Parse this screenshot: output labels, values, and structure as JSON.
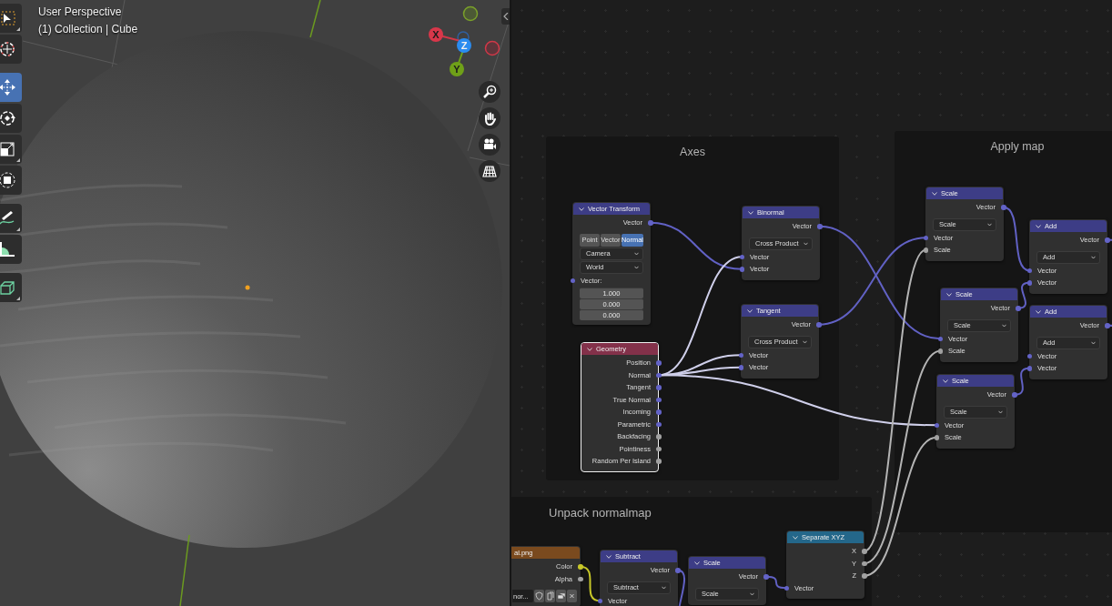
{
  "viewport": {
    "view_name": "User Perspective",
    "object_info": "(1) Collection | Cube",
    "toolbar": [
      {
        "tools": [
          {
            "selected": false
          },
          {
            "selected": false
          }
        ]
      },
      {
        "tools": [
          {
            "selected": true
          },
          {
            "selected": false
          },
          {
            "selected": false
          },
          {
            "selected": false
          }
        ]
      },
      {
        "tools": [
          {
            "selected": false
          },
          {
            "selected": false
          }
        ]
      },
      {
        "tools": [
          {
            "selected": false
          }
        ]
      }
    ],
    "gizmo": {
      "axes": [
        "X",
        "Y",
        "Z"
      ]
    }
  },
  "node_editor": {
    "frames": [
      {
        "label": "Axes"
      },
      {
        "label": "Apply map"
      },
      {
        "label": "Unpack normalmap"
      }
    ],
    "nodes": [
      {
        "title": "Vector Transform",
        "kind": "vector",
        "selected": false,
        "rows": [
          {
            "kind": "output",
            "label": "Vector",
            "color": "#6363c7"
          },
          {
            "kind": "toggle",
            "options": [
              {
                "label": "Point",
                "selected": false
              },
              {
                "label": "Vector",
                "selected": false
              },
              {
                "label": "Normal",
                "selected": true
              }
            ]
          },
          {
            "kind": "dropdown",
            "value": "Camera"
          },
          {
            "kind": "dropdown",
            "value": "World"
          },
          {
            "kind": "input",
            "label": "Vector:",
            "color": "#6363c7"
          },
          {
            "kind": "number",
            "value": "1.000"
          },
          {
            "kind": "number",
            "value": "0.000"
          },
          {
            "kind": "number",
            "value": "0.000"
          }
        ]
      },
      {
        "title": "Geometry",
        "kind": "input",
        "selected": true,
        "rows": [
          {
            "kind": "output",
            "label": "Position",
            "color": "#6363c7"
          },
          {
            "kind": "output",
            "label": "Normal",
            "color": "#6363c7"
          },
          {
            "kind": "output",
            "label": "Tangent",
            "color": "#6363c7"
          },
          {
            "kind": "output",
            "label": "True Normal",
            "color": "#6363c7"
          },
          {
            "kind": "output",
            "label": "Incoming",
            "color": "#6363c7"
          },
          {
            "kind": "output",
            "label": "Parametric",
            "color": "#6363c7"
          },
          {
            "kind": "output",
            "label": "Backfacing",
            "color": "#a1a1a1"
          },
          {
            "kind": "output",
            "label": "Pointiness",
            "color": "#a1a1a1"
          },
          {
            "kind": "output",
            "label": "Random Per Island",
            "color": "#a1a1a1"
          }
        ]
      },
      {
        "title": "Binormal",
        "kind": "vector",
        "selected": false,
        "rows": [
          {
            "kind": "output",
            "label": "Vector",
            "color": "#6363c7"
          },
          {
            "kind": "dropdown",
            "value": "Cross Product"
          },
          {
            "kind": "input",
            "label": "Vector",
            "color": "#6363c7"
          },
          {
            "kind": "input",
            "label": "Vector",
            "color": "#6363c7"
          }
        ]
      },
      {
        "title": "Tangent",
        "kind": "vector",
        "selected": false,
        "rows": [
          {
            "kind": "output",
            "label": "Vector",
            "color": "#6363c7"
          },
          {
            "kind": "dropdown",
            "value": "Cross Product"
          },
          {
            "kind": "input",
            "label": "Vector",
            "color": "#6363c7"
          },
          {
            "kind": "input",
            "label": "Vector",
            "color": "#6363c7"
          }
        ]
      },
      {
        "title": "Scale",
        "kind": "vector",
        "selected": false,
        "rows": [
          {
            "kind": "output",
            "label": "Vector",
            "color": "#6363c7"
          },
          {
            "kind": "dropdown",
            "value": "Scale"
          },
          {
            "kind": "input",
            "label": "Vector",
            "color": "#6363c7"
          },
          {
            "kind": "input",
            "label": "Scale",
            "color": "#a1a1a1"
          }
        ]
      },
      {
        "title": "Scale",
        "kind": "vector",
        "selected": false,
        "rows": [
          {
            "kind": "output",
            "label": "Vector",
            "color": "#6363c7"
          },
          {
            "kind": "dropdown",
            "value": "Scale"
          },
          {
            "kind": "input",
            "label": "Vector",
            "color": "#6363c7"
          },
          {
            "kind": "input",
            "label": "Scale",
            "color": "#a1a1a1"
          }
        ]
      },
      {
        "title": "Scale",
        "kind": "vector",
        "selected": false,
        "rows": [
          {
            "kind": "output",
            "label": "Vector",
            "color": "#6363c7"
          },
          {
            "kind": "dropdown",
            "value": "Scale"
          },
          {
            "kind": "input",
            "label": "Vector",
            "color": "#6363c7"
          },
          {
            "kind": "input",
            "label": "Scale",
            "color": "#a1a1a1"
          }
        ]
      },
      {
        "title": "Add",
        "kind": "vector",
        "selected": false,
        "rows": [
          {
            "kind": "output",
            "label": "Vector",
            "color": "#6363c7"
          },
          {
            "kind": "dropdown",
            "value": "Add"
          },
          {
            "kind": "input",
            "label": "Vector",
            "color": "#6363c7"
          },
          {
            "kind": "input",
            "label": "Vector",
            "color": "#6363c7"
          }
        ]
      },
      {
        "title": "Add",
        "kind": "vector",
        "selected": false,
        "rows": [
          {
            "kind": "output",
            "label": "Vector",
            "color": "#6363c7"
          },
          {
            "kind": "dropdown",
            "value": "Add"
          },
          {
            "kind": "input",
            "label": "Vector",
            "color": "#6363c7"
          },
          {
            "kind": "input",
            "label": "Vector",
            "color": "#6363c7"
          }
        ]
      },
      {
        "title": "al.png",
        "kind": "texture",
        "selected": false,
        "rows": [
          {
            "kind": "output",
            "label": "Color",
            "color": "#c7c729"
          },
          {
            "kind": "output",
            "label": "Alpha",
            "color": "#a1a1a1"
          },
          {
            "kind": "image",
            "value": "nor..."
          }
        ]
      },
      {
        "title": "Subtract",
        "kind": "vector",
        "selected": false,
        "rows": [
          {
            "kind": "output",
            "label": "Vector",
            "color": "#6363c7"
          },
          {
            "kind": "dropdown",
            "value": "Subtract"
          },
          {
            "kind": "input",
            "label": "Vector",
            "color": "#6363c7"
          }
        ]
      },
      {
        "title": "Scale",
        "kind": "vector",
        "selected": false,
        "rows": [
          {
            "kind": "output",
            "label": "Vector",
            "color": "#6363c7"
          },
          {
            "kind": "dropdown",
            "value": "Scale"
          }
        ]
      },
      {
        "title": "Separate XYZ",
        "kind": "converter",
        "selected": false,
        "rows": [
          {
            "kind": "output",
            "label": "X",
            "color": "#a1a1a1"
          },
          {
            "kind": "output",
            "label": "Y",
            "color": "#a1a1a1"
          },
          {
            "kind": "output",
            "label": "Z",
            "color": "#a1a1a1"
          },
          {
            "kind": "input",
            "label": "Vector",
            "color": "#6363c7"
          }
        ]
      }
    ]
  }
}
